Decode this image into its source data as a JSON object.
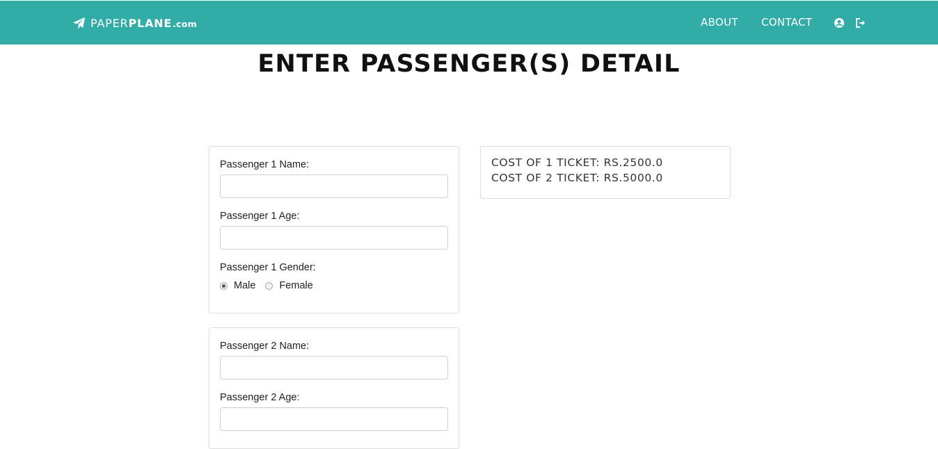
{
  "nav": {
    "brand_part1": "PAPER",
    "brand_part2": "PLANE",
    "brand_part3": ".com",
    "about_label": "ABOUT",
    "contact_label": "CONTACT",
    "icons": [
      "paper-plane-icon",
      "user-icon",
      "logout-icon"
    ]
  },
  "page": {
    "title": "ENTER PASSENGER(S) DETAIL"
  },
  "passengers": [
    {
      "name_label": "Passenger 1 Name:",
      "age_label": "Passenger 1 Age:",
      "gender_label": "Passenger 1 Gender:",
      "name_value": "",
      "age_value": "",
      "gender_options": [
        "Male",
        "Female"
      ],
      "gender_selected": "Male"
    },
    {
      "name_label": "Passenger 2 Name:",
      "age_label": "Passenger 2 Age:",
      "name_value": "",
      "age_value": ""
    }
  ],
  "cost": {
    "line1": "COST OF 1 TICKET: RS.2500.0",
    "line2": "COST OF 2 TICKET: RS.5000.0"
  },
  "colors": {
    "navbar": "#31aca7",
    "border": "#dcdcdc"
  }
}
